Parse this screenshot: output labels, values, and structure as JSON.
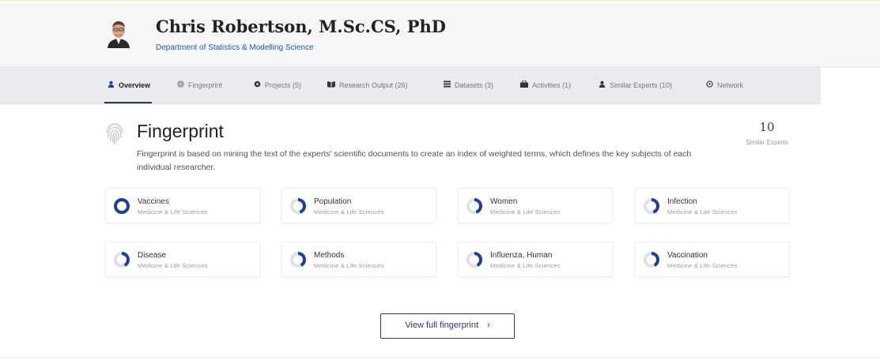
{
  "profile": {
    "name": "Chris Robertson, M.Sc.CS, PhD",
    "department": "Department of Statistics & Modelling Science"
  },
  "tabs": [
    {
      "label": "Overview",
      "icon": "person-icon",
      "active": true
    },
    {
      "label": "Fingerprint",
      "icon": "fingerprint-icon",
      "active": false
    },
    {
      "label": "Projects (5)",
      "icon": "projects-icon",
      "active": false
    },
    {
      "label": "Research Output (26)",
      "icon": "book-icon",
      "active": false
    },
    {
      "label": "Datasets (3)",
      "icon": "dataset-icon",
      "active": false
    },
    {
      "label": "Activities (1)",
      "icon": "briefcase-icon",
      "active": false
    },
    {
      "label": "Similar Experts (10)",
      "icon": "person-icon",
      "active": false
    },
    {
      "label": "Network",
      "icon": "network-icon",
      "active": false
    }
  ],
  "fingerprint": {
    "title": "Fingerprint",
    "description": "Fingerprint is based on mining the text of the experts' scientific documents to create an index of weighted terms, which defines the key subjects of each individual researcher.",
    "similar_count": "10",
    "similar_label": "Similar Experts",
    "concepts": [
      {
        "name": "Vaccines",
        "category": "Medicine & Life Sciences",
        "weight": 1.0
      },
      {
        "name": "Population",
        "category": "Medicine & Life Sciences",
        "weight": 0.45
      },
      {
        "name": "Women",
        "category": "Medicine & Life Sciences",
        "weight": 0.45
      },
      {
        "name": "Infection",
        "category": "Medicine & Life Sciences",
        "weight": 0.45
      },
      {
        "name": "Disease",
        "category": "Medicine & Life Sciences",
        "weight": 0.42
      },
      {
        "name": "Methods",
        "category": "Medicine & Life Sciences",
        "weight": 0.42
      },
      {
        "name": "Influenza, Human",
        "category": "Medicine & Life Sciences",
        "weight": 0.42
      },
      {
        "name": "Vaccination",
        "category": "Medicine & Life Sciences",
        "weight": 0.42
      }
    ],
    "button_label": "View full fingerprint",
    "button_icon": "chevron-right-icon"
  },
  "colors": {
    "accent": "#1f3f8f",
    "ring_bg": "#dde1e8"
  }
}
